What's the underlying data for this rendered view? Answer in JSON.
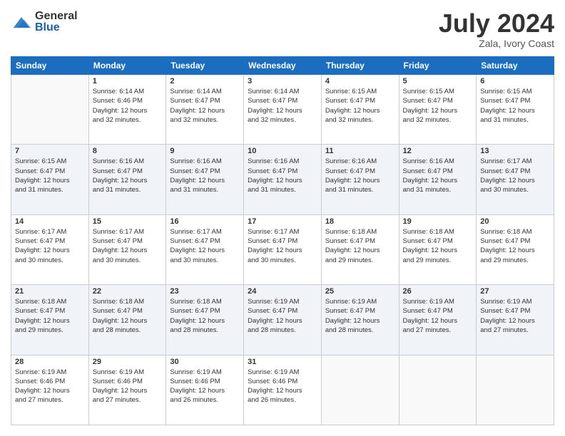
{
  "logo": {
    "general": "General",
    "blue": "Blue"
  },
  "title": "July 2024",
  "location": "Zala, Ivory Coast",
  "days_of_week": [
    "Sunday",
    "Monday",
    "Tuesday",
    "Wednesday",
    "Thursday",
    "Friday",
    "Saturday"
  ],
  "weeks": [
    [
      {
        "day": "",
        "sunrise": "",
        "sunset": "",
        "daylight": "",
        "minutes": ""
      },
      {
        "day": "1",
        "sunrise": "Sunrise: 6:14 AM",
        "sunset": "Sunset: 6:46 PM",
        "daylight": "Daylight: 12 hours",
        "minutes": "and 32 minutes."
      },
      {
        "day": "2",
        "sunrise": "Sunrise: 6:14 AM",
        "sunset": "Sunset: 6:47 PM",
        "daylight": "Daylight: 12 hours",
        "minutes": "and 32 minutes."
      },
      {
        "day": "3",
        "sunrise": "Sunrise: 6:14 AM",
        "sunset": "Sunset: 6:47 PM",
        "daylight": "Daylight: 12 hours",
        "minutes": "and 32 minutes."
      },
      {
        "day": "4",
        "sunrise": "Sunrise: 6:15 AM",
        "sunset": "Sunset: 6:47 PM",
        "daylight": "Daylight: 12 hours",
        "minutes": "and 32 minutes."
      },
      {
        "day": "5",
        "sunrise": "Sunrise: 6:15 AM",
        "sunset": "Sunset: 6:47 PM",
        "daylight": "Daylight: 12 hours",
        "minutes": "and 32 minutes."
      },
      {
        "day": "6",
        "sunrise": "Sunrise: 6:15 AM",
        "sunset": "Sunset: 6:47 PM",
        "daylight": "Daylight: 12 hours",
        "minutes": "and 31 minutes."
      }
    ],
    [
      {
        "day": "7",
        "sunrise": "Sunrise: 6:15 AM",
        "sunset": "Sunset: 6:47 PM",
        "daylight": "Daylight: 12 hours",
        "minutes": "and 31 minutes."
      },
      {
        "day": "8",
        "sunrise": "Sunrise: 6:16 AM",
        "sunset": "Sunset: 6:47 PM",
        "daylight": "Daylight: 12 hours",
        "minutes": "and 31 minutes."
      },
      {
        "day": "9",
        "sunrise": "Sunrise: 6:16 AM",
        "sunset": "Sunset: 6:47 PM",
        "daylight": "Daylight: 12 hours",
        "minutes": "and 31 minutes."
      },
      {
        "day": "10",
        "sunrise": "Sunrise: 6:16 AM",
        "sunset": "Sunset: 6:47 PM",
        "daylight": "Daylight: 12 hours",
        "minutes": "and 31 minutes."
      },
      {
        "day": "11",
        "sunrise": "Sunrise: 6:16 AM",
        "sunset": "Sunset: 6:47 PM",
        "daylight": "Daylight: 12 hours",
        "minutes": "and 31 minutes."
      },
      {
        "day": "12",
        "sunrise": "Sunrise: 6:16 AM",
        "sunset": "Sunset: 6:47 PM",
        "daylight": "Daylight: 12 hours",
        "minutes": "and 31 minutes."
      },
      {
        "day": "13",
        "sunrise": "Sunrise: 6:17 AM",
        "sunset": "Sunset: 6:47 PM",
        "daylight": "Daylight: 12 hours",
        "minutes": "and 30 minutes."
      }
    ],
    [
      {
        "day": "14",
        "sunrise": "Sunrise: 6:17 AM",
        "sunset": "Sunset: 6:47 PM",
        "daylight": "Daylight: 12 hours",
        "minutes": "and 30 minutes."
      },
      {
        "day": "15",
        "sunrise": "Sunrise: 6:17 AM",
        "sunset": "Sunset: 6:47 PM",
        "daylight": "Daylight: 12 hours",
        "minutes": "and 30 minutes."
      },
      {
        "day": "16",
        "sunrise": "Sunrise: 6:17 AM",
        "sunset": "Sunset: 6:47 PM",
        "daylight": "Daylight: 12 hours",
        "minutes": "and 30 minutes."
      },
      {
        "day": "17",
        "sunrise": "Sunrise: 6:17 AM",
        "sunset": "Sunset: 6:47 PM",
        "daylight": "Daylight: 12 hours",
        "minutes": "and 30 minutes."
      },
      {
        "day": "18",
        "sunrise": "Sunrise: 6:18 AM",
        "sunset": "Sunset: 6:47 PM",
        "daylight": "Daylight: 12 hours",
        "minutes": "and 29 minutes."
      },
      {
        "day": "19",
        "sunrise": "Sunrise: 6:18 AM",
        "sunset": "Sunset: 6:47 PM",
        "daylight": "Daylight: 12 hours",
        "minutes": "and 29 minutes."
      },
      {
        "day": "20",
        "sunrise": "Sunrise: 6:18 AM",
        "sunset": "Sunset: 6:47 PM",
        "daylight": "Daylight: 12 hours",
        "minutes": "and 29 minutes."
      }
    ],
    [
      {
        "day": "21",
        "sunrise": "Sunrise: 6:18 AM",
        "sunset": "Sunset: 6:47 PM",
        "daylight": "Daylight: 12 hours",
        "minutes": "and 29 minutes."
      },
      {
        "day": "22",
        "sunrise": "Sunrise: 6:18 AM",
        "sunset": "Sunset: 6:47 PM",
        "daylight": "Daylight: 12 hours",
        "minutes": "and 28 minutes."
      },
      {
        "day": "23",
        "sunrise": "Sunrise: 6:18 AM",
        "sunset": "Sunset: 6:47 PM",
        "daylight": "Daylight: 12 hours",
        "minutes": "and 28 minutes."
      },
      {
        "day": "24",
        "sunrise": "Sunrise: 6:19 AM",
        "sunset": "Sunset: 6:47 PM",
        "daylight": "Daylight: 12 hours",
        "minutes": "and 28 minutes."
      },
      {
        "day": "25",
        "sunrise": "Sunrise: 6:19 AM",
        "sunset": "Sunset: 6:47 PM",
        "daylight": "Daylight: 12 hours",
        "minutes": "and 28 minutes."
      },
      {
        "day": "26",
        "sunrise": "Sunrise: 6:19 AM",
        "sunset": "Sunset: 6:47 PM",
        "daylight": "Daylight: 12 hours",
        "minutes": "and 27 minutes."
      },
      {
        "day": "27",
        "sunrise": "Sunrise: 6:19 AM",
        "sunset": "Sunset: 6:47 PM",
        "daylight": "Daylight: 12 hours",
        "minutes": "and 27 minutes."
      }
    ],
    [
      {
        "day": "28",
        "sunrise": "Sunrise: 6:19 AM",
        "sunset": "Sunset: 6:46 PM",
        "daylight": "Daylight: 12 hours",
        "minutes": "and 27 minutes."
      },
      {
        "day": "29",
        "sunrise": "Sunrise: 6:19 AM",
        "sunset": "Sunset: 6:46 PM",
        "daylight": "Daylight: 12 hours",
        "minutes": "and 27 minutes."
      },
      {
        "day": "30",
        "sunrise": "Sunrise: 6:19 AM",
        "sunset": "Sunset: 6:46 PM",
        "daylight": "Daylight: 12 hours",
        "minutes": "and 26 minutes."
      },
      {
        "day": "31",
        "sunrise": "Sunrise: 6:19 AM",
        "sunset": "Sunset: 6:46 PM",
        "daylight": "Daylight: 12 hours",
        "minutes": "and 26 minutes."
      },
      {
        "day": "",
        "sunrise": "",
        "sunset": "",
        "daylight": "",
        "minutes": ""
      },
      {
        "day": "",
        "sunrise": "",
        "sunset": "",
        "daylight": "",
        "minutes": ""
      },
      {
        "day": "",
        "sunrise": "",
        "sunset": "",
        "daylight": "",
        "minutes": ""
      }
    ]
  ]
}
